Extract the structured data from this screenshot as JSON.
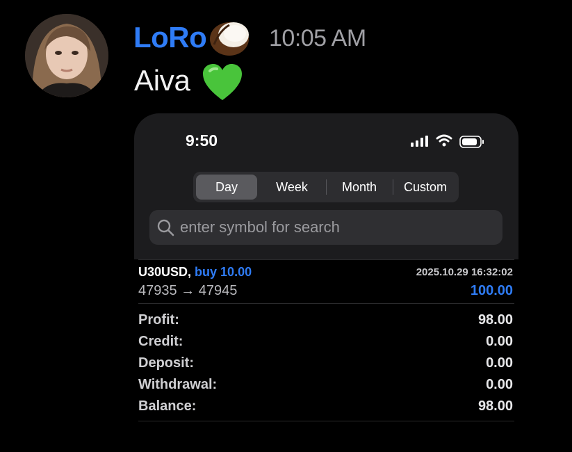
{
  "message": {
    "author": "LoRo",
    "timestamp": "10:05 AM",
    "text": "Aiva",
    "author_emoji": "coconut-icon",
    "text_emoji": "green-heart-icon"
  },
  "screenshot": {
    "status_bar": {
      "time": "9:50"
    },
    "segments": [
      {
        "label": "Day",
        "active": true
      },
      {
        "label": "Week",
        "active": false
      },
      {
        "label": "Month",
        "active": false
      },
      {
        "label": "Custom",
        "active": false
      }
    ],
    "search": {
      "placeholder": "enter symbol for search"
    },
    "deal": {
      "symbol": "U30USD,",
      "action": "buy 10.00",
      "datetime": "2025.10.29 16:32:02",
      "prices": "47935 → 47945",
      "profit": "100.00"
    },
    "summary": [
      {
        "label": "Profit:",
        "value": "98.00"
      },
      {
        "label": "Credit:",
        "value": "0.00"
      },
      {
        "label": "Deposit:",
        "value": "0.00"
      },
      {
        "label": "Withdrawal:",
        "value": "0.00"
      },
      {
        "label": "Balance:",
        "value": "98.00"
      }
    ]
  },
  "colors": {
    "accent": "#2f7cf6",
    "background": "#000000",
    "panel": "#1c1c1e"
  }
}
